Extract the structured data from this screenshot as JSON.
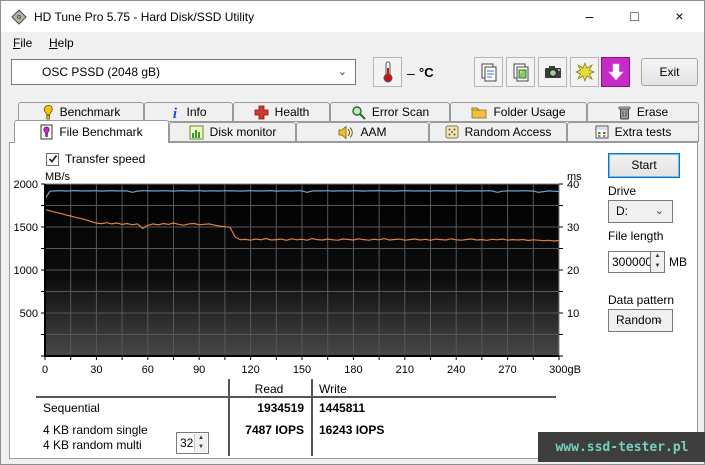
{
  "window": {
    "title": "HD Tune Pro 5.75 - Hard Disk/SSD Utility",
    "minimize_glyph": "–",
    "maximize_glyph": "□",
    "close_glyph": "×"
  },
  "menu": {
    "file_label": "File",
    "help_label": "Help"
  },
  "toolbar": {
    "drive_selector_value": "OSC PSSD (2048 gB)",
    "temperature_value": "–",
    "temperature_unit": "°C",
    "exit_label": "Exit",
    "chevron_glyph": "⌄"
  },
  "tabs": {
    "row1": [
      {
        "label": "Benchmark"
      },
      {
        "label": "Info"
      },
      {
        "label": "Health"
      },
      {
        "label": "Error Scan"
      },
      {
        "label": "Folder Usage"
      },
      {
        "label": "Erase"
      }
    ],
    "row2": [
      {
        "label": "File Benchmark"
      },
      {
        "label": "Disk monitor"
      },
      {
        "label": "AAM"
      },
      {
        "label": "Random Access"
      },
      {
        "label": "Extra tests"
      }
    ],
    "active": "File Benchmark"
  },
  "controls": {
    "transfer_speed_label": "Transfer speed",
    "start_label": "Start",
    "drive_label": "Drive",
    "drive_value": "D:",
    "file_length_label": "File length",
    "file_length_value": "300000",
    "file_length_unit": "MB",
    "data_pattern_label": "Data pattern",
    "data_pattern_value": "Random",
    "spin_up_glyph": "▲",
    "spin_down_glyph": "▼"
  },
  "results": {
    "col_read": "Read",
    "col_write": "Write",
    "rows": [
      {
        "label": "Sequential",
        "read": "1934519",
        "write": "1445811"
      },
      {
        "label": "4 KB random single",
        "read": "7487 IOPS",
        "write": "16243 IOPS"
      },
      {
        "label": "4 KB random multi",
        "read": "",
        "write": "",
        "spinner_value": "32"
      }
    ]
  },
  "watermark": "www.ssd-tester.pl",
  "colors": {
    "read_line": "#6ba7d6",
    "write_line": "#de8142",
    "grid": "#585858",
    "chart_top": "#000000",
    "chart_bottom": "#484848",
    "capture_button": "#c72bc7",
    "watermark_bg": "#3e3e3e",
    "watermark_text": "#76d0bf"
  },
  "chart_data": {
    "type": "line",
    "title": "",
    "xlabel": "gB",
    "ylabel_left": "MB/s",
    "ylabel_right": "ms",
    "xlim": [
      0,
      300
    ],
    "ylim_left": [
      0,
      2000
    ],
    "ylim_right": [
      0,
      40
    ],
    "grid": true,
    "x_major_ticks": [
      0,
      30,
      60,
      90,
      120,
      150,
      180,
      210,
      240,
      270,
      300
    ],
    "x_last_tick_label": "300gB",
    "x_minor_step": 15,
    "y_left_labels": [
      500,
      1000,
      1500,
      2000
    ],
    "y_grid_step_left": 250,
    "y_right_labels": [
      10,
      20,
      30,
      40
    ],
    "y_right_tick_step": 5,
    "x_step_gb": 3,
    "series": [
      {
        "name": "Read speed",
        "color": "#6ba7d6",
        "values": [
          1830,
          1916,
          1920,
          1922,
          1918,
          1921,
          1923,
          1919,
          1921,
          1920,
          1922,
          1918,
          1920,
          1923,
          1919,
          1921,
          1920,
          1904,
          1918,
          1922,
          1920,
          1921,
          1919,
          1922,
          1920,
          1918,
          1921,
          1923,
          1919,
          1920,
          1922,
          1918,
          1921,
          1920,
          1919,
          1922,
          1920,
          1921,
          1918,
          1920,
          1922,
          1919,
          1921,
          1920,
          1923,
          1918,
          1920,
          1921,
          1919,
          1922,
          1920,
          1903,
          1919,
          1921,
          1920,
          1922,
          1918,
          1920,
          1921,
          1919,
          1922,
          1920,
          1918,
          1921,
          1920,
          1922,
          1919,
          1921,
          1918,
          1920,
          1922,
          1920,
          1919,
          1921,
          1920,
          1918,
          1922,
          1920,
          1921,
          1919,
          1920,
          1922,
          1918,
          1920,
          1921,
          1919,
          1922,
          1920,
          1903,
          1916,
          1920,
          1921,
          1919,
          1922,
          1920,
          1918,
          1904,
          1912,
          1920,
          1916,
          1912
        ]
      },
      {
        "name": "Write speed",
        "color": "#de8142",
        "values": [
          1705,
          1688,
          1672,
          1658,
          1642,
          1628,
          1612,
          1598,
          1582,
          1562,
          1545,
          1540,
          1550,
          1536,
          1546,
          1530,
          1541,
          1526,
          1536,
          1482,
          1519,
          1536,
          1524,
          1541,
          1530,
          1546,
          1531,
          1521,
          1536,
          1541,
          1526,
          1531,
          1536,
          1521,
          1511,
          1504,
          1496,
          1382,
          1352,
          1356,
          1346,
          1361,
          1351,
          1366,
          1349,
          1353,
          1359,
          1345,
          1363,
          1351,
          1357,
          1347,
          1365,
          1353,
          1349,
          1359,
          1351,
          1346,
          1361,
          1355,
          1349,
          1363,
          1353,
          1347,
          1357,
          1351,
          1365,
          1349,
          1355,
          1359,
          1347,
          1353,
          1361,
          1349,
          1357,
          1345,
          1359,
          1353,
          1349,
          1363,
          1351,
          1347,
          1355,
          1361,
          1349,
          1353,
          1345,
          1357,
          1351,
          1359,
          1347,
          1353,
          1349,
          1355,
          1343,
          1351,
          1347,
          1341,
          1345,
          1337,
          1343
        ]
      }
    ]
  }
}
